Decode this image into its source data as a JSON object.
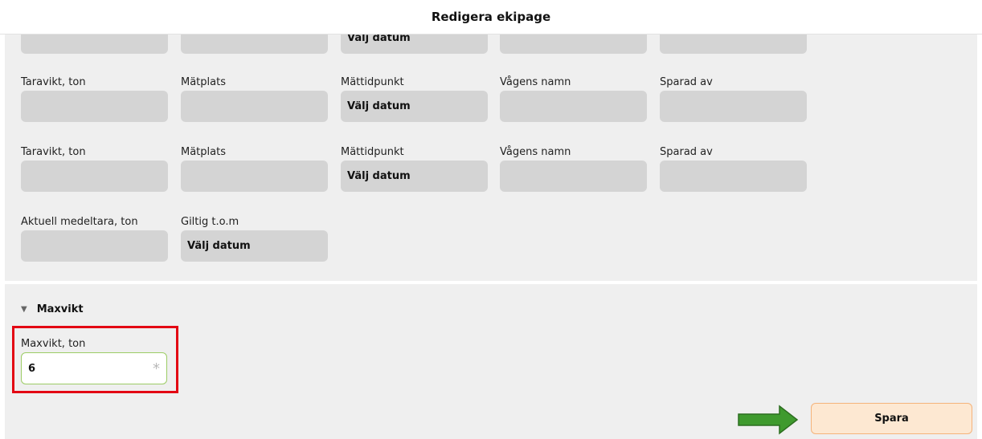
{
  "header": {
    "title": "Redigera ekipage"
  },
  "rows": [
    {
      "fields": [
        {
          "type": "text"
        },
        {
          "type": "text"
        },
        {
          "type": "date",
          "value": "Välj datum"
        },
        {
          "type": "text"
        },
        {
          "type": "text"
        }
      ]
    },
    {
      "labels": [
        "Taravikt, ton",
        "Mätplats",
        "Mättidpunkt",
        "Vågens namn",
        "Sparad av"
      ],
      "date_value": "Välj datum"
    },
    {
      "labels": [
        "Taravikt, ton",
        "Mätplats",
        "Mättidpunkt",
        "Vågens namn",
        "Sparad av"
      ],
      "date_value": "Välj datum"
    },
    {
      "labels": [
        "Aktuell medeltara, ton",
        "Giltig t.o.m"
      ],
      "date_value": "Välj datum"
    }
  ],
  "maxvikt": {
    "section_title": "Maxvikt",
    "toggle_icon": "triangle-down-icon",
    "field_label": "Maxvikt, ton",
    "field_value": "6",
    "required_marker": "*"
  },
  "actions": {
    "save_label": "Spara",
    "arrow_icon": "green-arrow-icon"
  },
  "colors": {
    "field_bg": "#d4d4d4",
    "panel_bg": "#efefef",
    "highlight": "#e30613",
    "arrow": "#3f9a2e",
    "save_bg": "#fde8d2",
    "save_border": "#f5b37a",
    "valid_border": "#9ccc65"
  }
}
